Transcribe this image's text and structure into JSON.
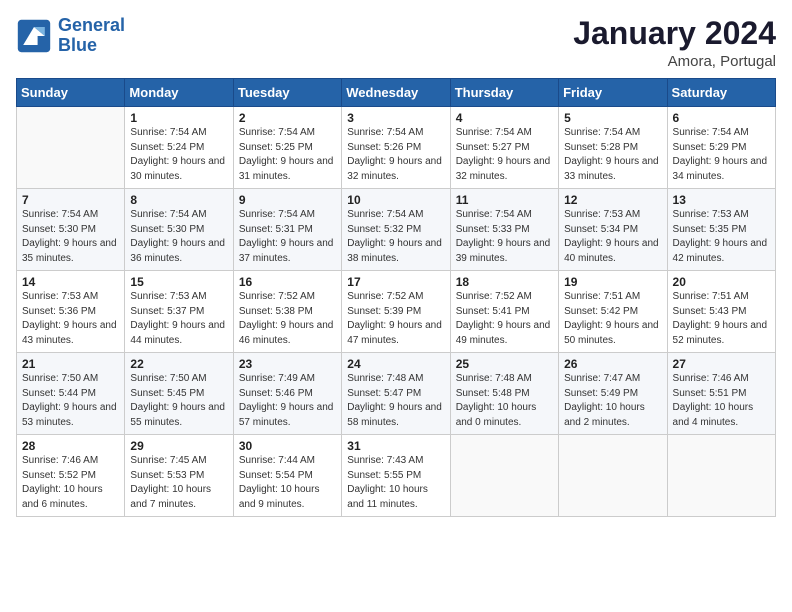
{
  "header": {
    "logo_line1": "General",
    "logo_line2": "Blue",
    "month_title": "January 2024",
    "location": "Amora, Portugal"
  },
  "days_of_week": [
    "Sunday",
    "Monday",
    "Tuesday",
    "Wednesday",
    "Thursday",
    "Friday",
    "Saturday"
  ],
  "weeks": [
    [
      {
        "day": "",
        "sunrise": "",
        "sunset": "",
        "daylight": ""
      },
      {
        "day": "1",
        "sunrise": "Sunrise: 7:54 AM",
        "sunset": "Sunset: 5:24 PM",
        "daylight": "Daylight: 9 hours and 30 minutes."
      },
      {
        "day": "2",
        "sunrise": "Sunrise: 7:54 AM",
        "sunset": "Sunset: 5:25 PM",
        "daylight": "Daylight: 9 hours and 31 minutes."
      },
      {
        "day": "3",
        "sunrise": "Sunrise: 7:54 AM",
        "sunset": "Sunset: 5:26 PM",
        "daylight": "Daylight: 9 hours and 32 minutes."
      },
      {
        "day": "4",
        "sunrise": "Sunrise: 7:54 AM",
        "sunset": "Sunset: 5:27 PM",
        "daylight": "Daylight: 9 hours and 32 minutes."
      },
      {
        "day": "5",
        "sunrise": "Sunrise: 7:54 AM",
        "sunset": "Sunset: 5:28 PM",
        "daylight": "Daylight: 9 hours and 33 minutes."
      },
      {
        "day": "6",
        "sunrise": "Sunrise: 7:54 AM",
        "sunset": "Sunset: 5:29 PM",
        "daylight": "Daylight: 9 hours and 34 minutes."
      }
    ],
    [
      {
        "day": "7",
        "sunrise": "Sunrise: 7:54 AM",
        "sunset": "Sunset: 5:30 PM",
        "daylight": "Daylight: 9 hours and 35 minutes."
      },
      {
        "day": "8",
        "sunrise": "Sunrise: 7:54 AM",
        "sunset": "Sunset: 5:30 PM",
        "daylight": "Daylight: 9 hours and 36 minutes."
      },
      {
        "day": "9",
        "sunrise": "Sunrise: 7:54 AM",
        "sunset": "Sunset: 5:31 PM",
        "daylight": "Daylight: 9 hours and 37 minutes."
      },
      {
        "day": "10",
        "sunrise": "Sunrise: 7:54 AM",
        "sunset": "Sunset: 5:32 PM",
        "daylight": "Daylight: 9 hours and 38 minutes."
      },
      {
        "day": "11",
        "sunrise": "Sunrise: 7:54 AM",
        "sunset": "Sunset: 5:33 PM",
        "daylight": "Daylight: 9 hours and 39 minutes."
      },
      {
        "day": "12",
        "sunrise": "Sunrise: 7:53 AM",
        "sunset": "Sunset: 5:34 PM",
        "daylight": "Daylight: 9 hours and 40 minutes."
      },
      {
        "day": "13",
        "sunrise": "Sunrise: 7:53 AM",
        "sunset": "Sunset: 5:35 PM",
        "daylight": "Daylight: 9 hours and 42 minutes."
      }
    ],
    [
      {
        "day": "14",
        "sunrise": "Sunrise: 7:53 AM",
        "sunset": "Sunset: 5:36 PM",
        "daylight": "Daylight: 9 hours and 43 minutes."
      },
      {
        "day": "15",
        "sunrise": "Sunrise: 7:53 AM",
        "sunset": "Sunset: 5:37 PM",
        "daylight": "Daylight: 9 hours and 44 minutes."
      },
      {
        "day": "16",
        "sunrise": "Sunrise: 7:52 AM",
        "sunset": "Sunset: 5:38 PM",
        "daylight": "Daylight: 9 hours and 46 minutes."
      },
      {
        "day": "17",
        "sunrise": "Sunrise: 7:52 AM",
        "sunset": "Sunset: 5:39 PM",
        "daylight": "Daylight: 9 hours and 47 minutes."
      },
      {
        "day": "18",
        "sunrise": "Sunrise: 7:52 AM",
        "sunset": "Sunset: 5:41 PM",
        "daylight": "Daylight: 9 hours and 49 minutes."
      },
      {
        "day": "19",
        "sunrise": "Sunrise: 7:51 AM",
        "sunset": "Sunset: 5:42 PM",
        "daylight": "Daylight: 9 hours and 50 minutes."
      },
      {
        "day": "20",
        "sunrise": "Sunrise: 7:51 AM",
        "sunset": "Sunset: 5:43 PM",
        "daylight": "Daylight: 9 hours and 52 minutes."
      }
    ],
    [
      {
        "day": "21",
        "sunrise": "Sunrise: 7:50 AM",
        "sunset": "Sunset: 5:44 PM",
        "daylight": "Daylight: 9 hours and 53 minutes."
      },
      {
        "day": "22",
        "sunrise": "Sunrise: 7:50 AM",
        "sunset": "Sunset: 5:45 PM",
        "daylight": "Daylight: 9 hours and 55 minutes."
      },
      {
        "day": "23",
        "sunrise": "Sunrise: 7:49 AM",
        "sunset": "Sunset: 5:46 PM",
        "daylight": "Daylight: 9 hours and 57 minutes."
      },
      {
        "day": "24",
        "sunrise": "Sunrise: 7:48 AM",
        "sunset": "Sunset: 5:47 PM",
        "daylight": "Daylight: 9 hours and 58 minutes."
      },
      {
        "day": "25",
        "sunrise": "Sunrise: 7:48 AM",
        "sunset": "Sunset: 5:48 PM",
        "daylight": "Daylight: 10 hours and 0 minutes."
      },
      {
        "day": "26",
        "sunrise": "Sunrise: 7:47 AM",
        "sunset": "Sunset: 5:49 PM",
        "daylight": "Daylight: 10 hours and 2 minutes."
      },
      {
        "day": "27",
        "sunrise": "Sunrise: 7:46 AM",
        "sunset": "Sunset: 5:51 PM",
        "daylight": "Daylight: 10 hours and 4 minutes."
      }
    ],
    [
      {
        "day": "28",
        "sunrise": "Sunrise: 7:46 AM",
        "sunset": "Sunset: 5:52 PM",
        "daylight": "Daylight: 10 hours and 6 minutes."
      },
      {
        "day": "29",
        "sunrise": "Sunrise: 7:45 AM",
        "sunset": "Sunset: 5:53 PM",
        "daylight": "Daylight: 10 hours and 7 minutes."
      },
      {
        "day": "30",
        "sunrise": "Sunrise: 7:44 AM",
        "sunset": "Sunset: 5:54 PM",
        "daylight": "Daylight: 10 hours and 9 minutes."
      },
      {
        "day": "31",
        "sunrise": "Sunrise: 7:43 AM",
        "sunset": "Sunset: 5:55 PM",
        "daylight": "Daylight: 10 hours and 11 minutes."
      },
      {
        "day": "",
        "sunrise": "",
        "sunset": "",
        "daylight": ""
      },
      {
        "day": "",
        "sunrise": "",
        "sunset": "",
        "daylight": ""
      },
      {
        "day": "",
        "sunrise": "",
        "sunset": "",
        "daylight": ""
      }
    ]
  ]
}
